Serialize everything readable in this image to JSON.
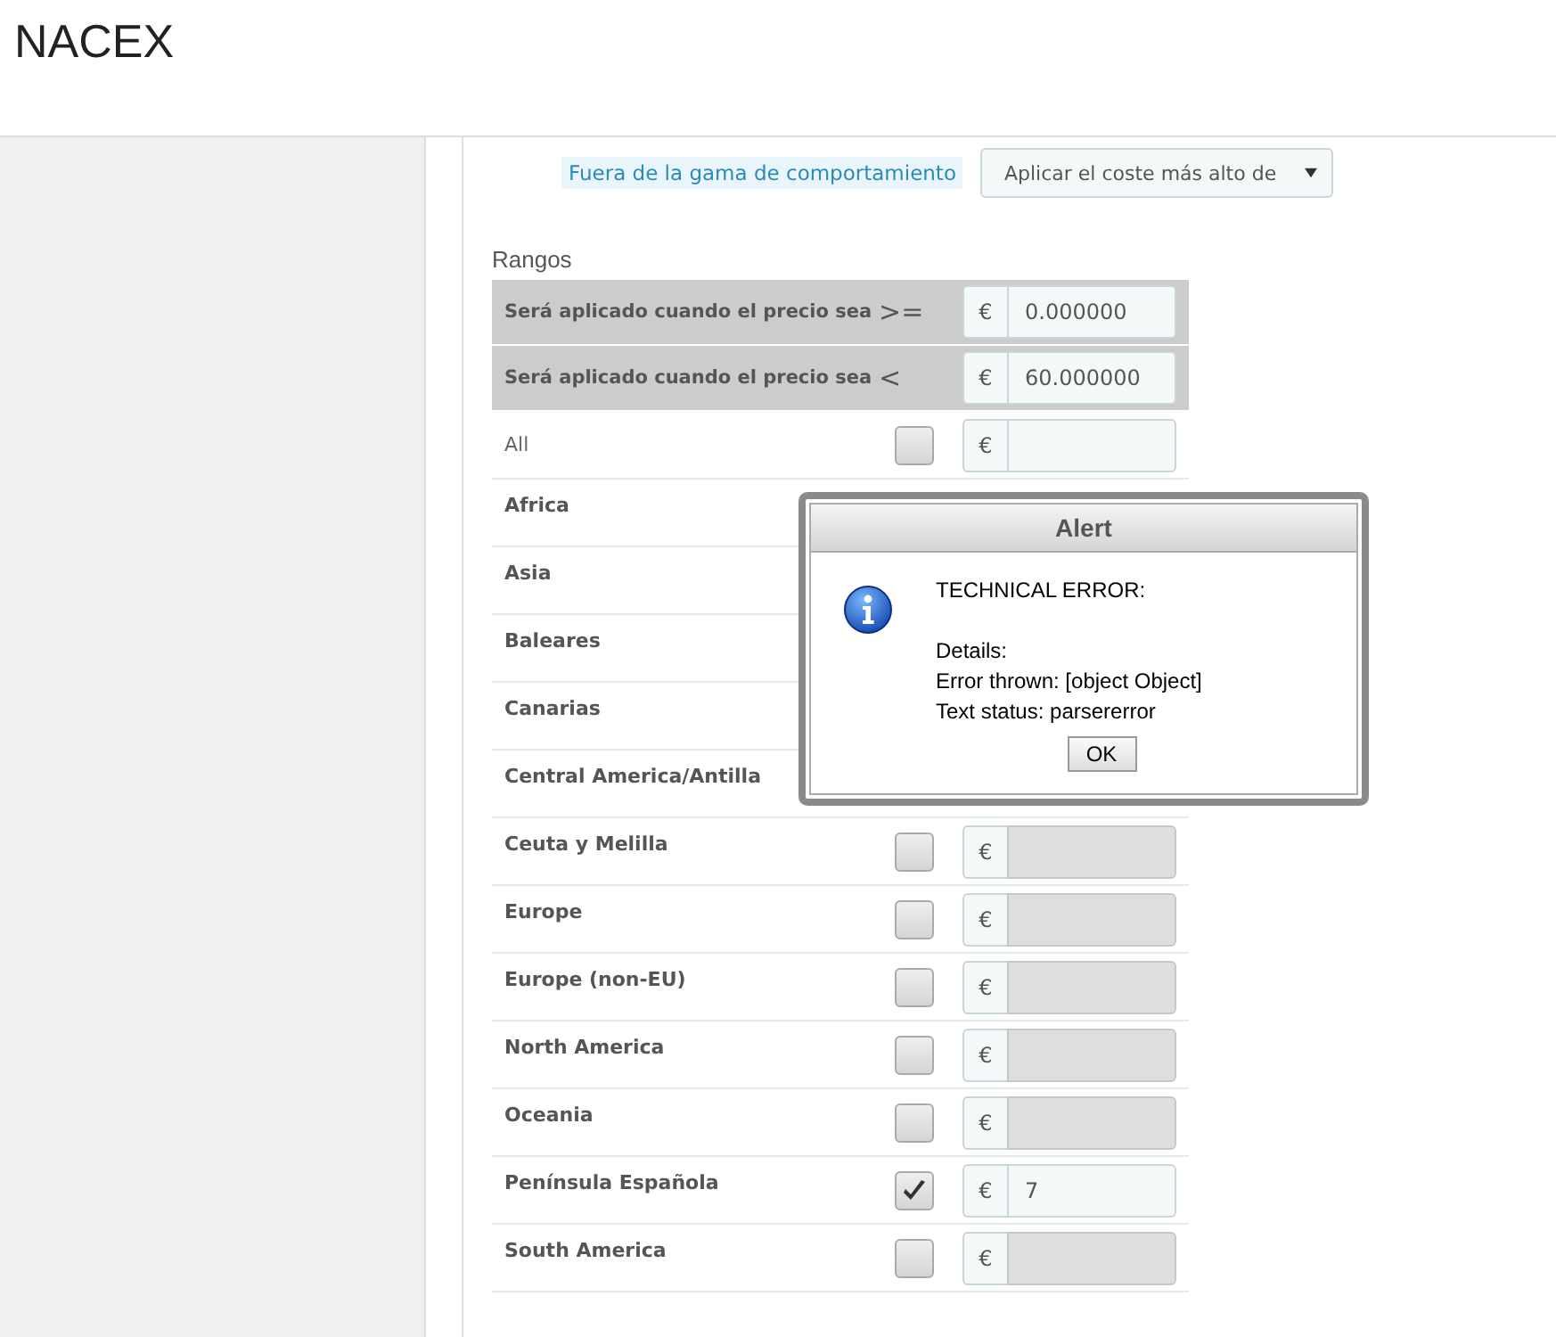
{
  "header": {
    "title": "NACEX"
  },
  "behavior": {
    "label": "Fuera de la gama de comportamiento",
    "select_value": "Aplicar el coste más alto de"
  },
  "ranges": {
    "title": "Rangos",
    "conditions": [
      {
        "label": "Será aplicado cuando el precio sea",
        "operator": ">=",
        "currency": "€",
        "value": "0.000000"
      },
      {
        "label": "Será aplicado cuando el precio sea",
        "operator": "<",
        "currency": "€",
        "value": "60.000000"
      }
    ],
    "zones": [
      {
        "name": "All",
        "bold": false,
        "checked": false,
        "currency": "€",
        "disabled": false
      },
      {
        "name": "Africa",
        "bold": true
      },
      {
        "name": "Asia",
        "bold": true
      },
      {
        "name": "Baleares",
        "bold": true
      },
      {
        "name": "Canarias",
        "bold": true
      },
      {
        "name": "Central America/Antilla",
        "bold": true
      },
      {
        "name": "Ceuta y Melilla",
        "bold": true,
        "checked": false,
        "currency": "€",
        "disabled": true
      },
      {
        "name": "Europe",
        "bold": true,
        "checked": false,
        "currency": "€",
        "disabled": true
      },
      {
        "name": "Europe (non-EU)",
        "bold": true,
        "checked": false,
        "currency": "€",
        "disabled": true
      },
      {
        "name": "North America",
        "bold": true,
        "checked": false,
        "currency": "€",
        "disabled": true
      },
      {
        "name": "Oceania",
        "bold": true,
        "checked": false,
        "currency": "€",
        "disabled": true
      },
      {
        "name": "Península Española",
        "bold": true,
        "checked": true,
        "currency": "€",
        "disabled": false,
        "value": "7"
      },
      {
        "name": "South America",
        "bold": true,
        "checked": false,
        "currency": "€",
        "disabled": true
      }
    ]
  },
  "alert": {
    "title": "Alert",
    "lines": [
      "TECHNICAL ERROR:",
      "Details:",
      "Error thrown: [object Object]",
      "Text status: parsererror"
    ],
    "button": "OK"
  }
}
